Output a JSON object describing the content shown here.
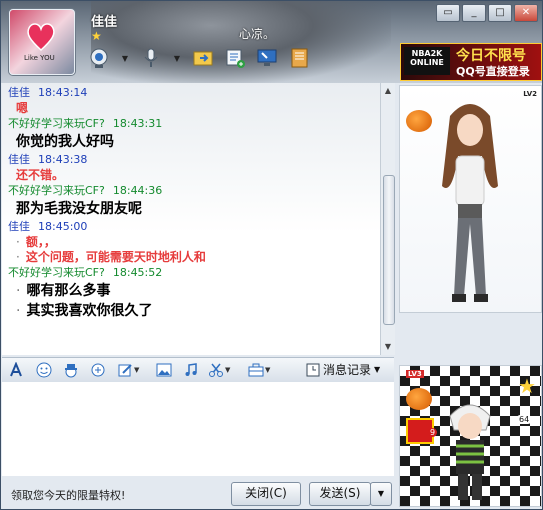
{
  "contact": {
    "name": "佳佳",
    "signature": "心凉。"
  },
  "window_buttons": {
    "minimize": "▭",
    "maximize": "_",
    "restore": "□",
    "close": "✕"
  },
  "ad": {
    "logo": "NBA2K ONLINE",
    "line1": "今日不限号",
    "line2": "QQ号直接登录"
  },
  "messages": [
    {
      "sender": "佳佳",
      "time": "18:43:14",
      "color": "blue",
      "lines": [
        "嗯"
      ],
      "style": "red"
    },
    {
      "sender": "不好好学习来玩CF?",
      "time": "18:43:31",
      "color": "green",
      "lines": [
        "你觉的我人好吗"
      ],
      "style": "bold"
    },
    {
      "sender": "佳佳",
      "time": "18:43:38",
      "color": "blue",
      "lines": [
        "还不错。"
      ],
      "style": "red"
    },
    {
      "sender": "不好好学习来玩CF?",
      "time": "18:44:36",
      "color": "green",
      "lines": [
        "那为毛我没女朋友呢"
      ],
      "style": "bold"
    },
    {
      "sender": "佳佳",
      "time": "18:45:00",
      "color": "blue",
      "lines": [
        "额，，",
        "这个问题，可能需要天时地利人和"
      ],
      "style": "red"
    },
    {
      "sender": "不好好学习来玩CF?",
      "time": "18:45:52",
      "color": "green",
      "lines": [
        "哪有那么多事",
        "其实我喜欢你很久了"
      ],
      "style": "bold"
    }
  ],
  "toolbar": {
    "history_label": "消息记录"
  },
  "footer": {
    "hint": "领取您今天的限量特权!",
    "close_label": "关闭(C)",
    "send_label": "发送(S)",
    "send_dropdown": "▼"
  },
  "show": {
    "top_level": "LV2",
    "bottom_level": "LV3",
    "bottom_count": "64",
    "gift_count": "9"
  },
  "avatar_text": "Like YOU",
  "colors": {
    "blue_name": "#1e3fb8",
    "green_name": "#148a2e",
    "red_text": "#e63c3c"
  }
}
